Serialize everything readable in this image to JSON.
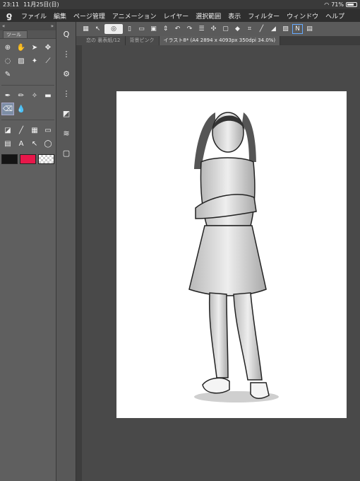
{
  "status": {
    "time": "23:11",
    "date": "11月25日(日)",
    "battery": "71%",
    "battery_level": 0.71
  },
  "menu": {
    "items": [
      "ファイル",
      "編集",
      "ページ管理",
      "アニメーション",
      "レイヤー",
      "選択範囲",
      "表示",
      "フィルター",
      "ウィンドウ",
      "ヘルプ"
    ]
  },
  "tool_panel": {
    "title": "ツール"
  },
  "colors": {
    "main": "#141414",
    "sub": "#e8174a"
  },
  "doc_tabs": [
    {
      "label": "恋の 裏表紙/12"
    },
    {
      "label": "背景ピンク"
    },
    {
      "label": "イラスト8* (A4 2894 x 4093px 350dpi 34.0%)"
    }
  ]
}
